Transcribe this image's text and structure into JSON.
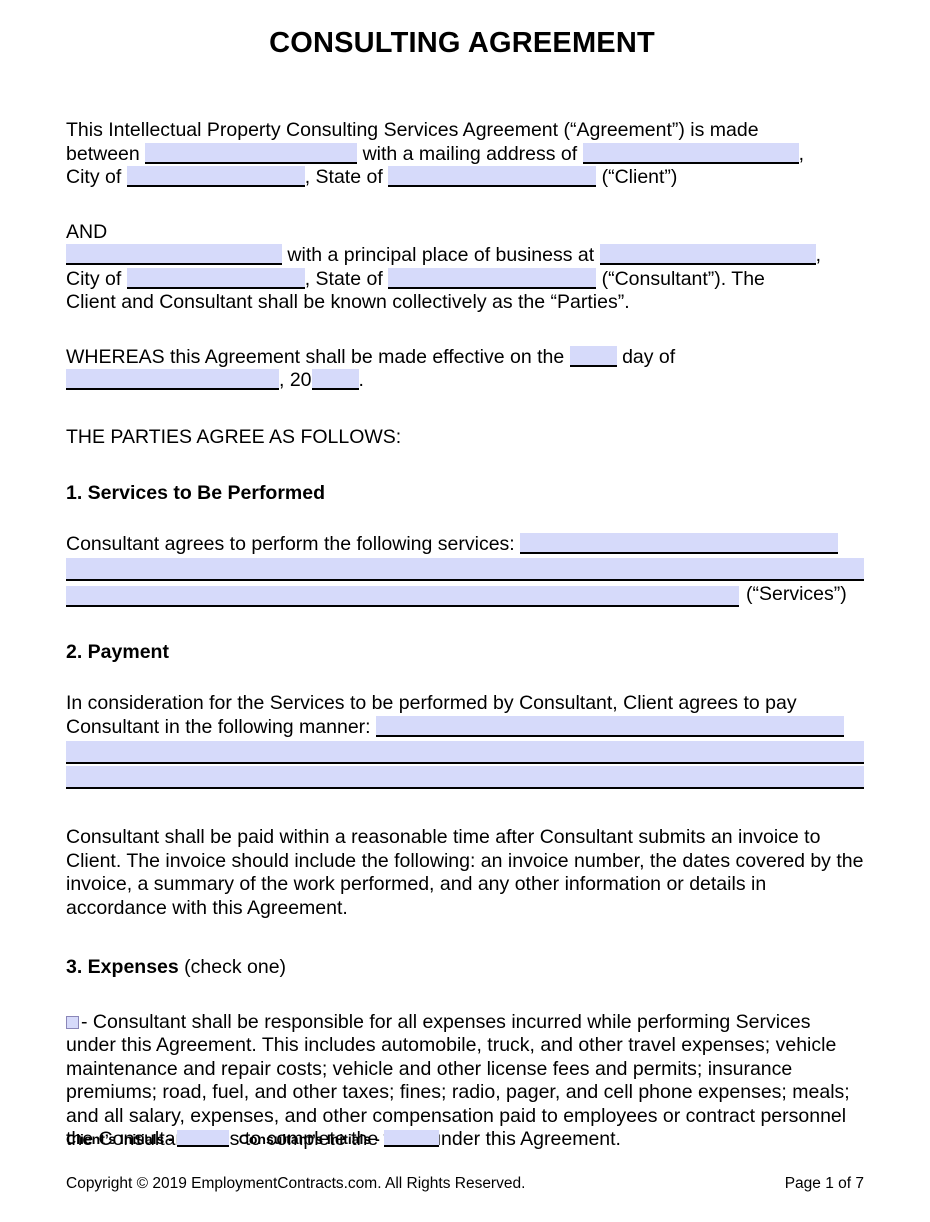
{
  "document": {
    "title": "CONSULTING AGREEMENT",
    "intro": {
      "line1_a": "This Intellectual Property Consulting Services Agreement (“Agreement”) is made",
      "line2_a": "between",
      "line2_b": "with a mailing address of",
      "line2_c": ",",
      "line3_a": "City of",
      "line3_b": ", State of",
      "line3_c": "(“Client”)"
    },
    "and_block": {
      "and_label": "AND",
      "line1_b": "with a principal place of business at",
      "line1_c": ",",
      "line2_a": "City of",
      "line2_b": ", State of",
      "line2_c": "(“Consultant”). The",
      "line3": "Client and Consultant shall be known collectively as the “Parties”."
    },
    "whereas": {
      "line1_a": "WHEREAS this Agreement shall be made effective on the",
      "line1_b": "day of",
      "line2_a": ", 20",
      "line2_b": "."
    },
    "parties_agree": "THE PARTIES AGREE AS FOLLOWS:",
    "section1": {
      "heading": "1. Services to Be Performed",
      "intro": "Consultant agrees to perform the following services:",
      "tail": "(“Services”)"
    },
    "section2": {
      "heading": "2. Payment",
      "intro_line1": "In consideration for the Services to be performed by Consultant, Client agrees to pay",
      "intro_line2": "Consultant in the following manner:",
      "invoice_paragraph": "Consultant shall be paid within a reasonable time after Consultant submits an invoice to Client. The invoice should include the following: an invoice number, the dates covered by the invoice, a summary of the work performed, and any other information or details in accordance with this Agreement."
    },
    "section3": {
      "heading_bold": "3. Expenses",
      "heading_normal": "(check one)",
      "option_a_dash": "-",
      "option_a_text": "Consultant shall be responsible for all expenses incurred while performing Services under this Agreement. This includes automobile, truck, and other travel expenses; vehicle maintenance and repair costs; vehicle and other license fees and permits; insurance premiums; road, fuel, and other taxes; fines; radio, pager, and cell phone expenses; meals; and all salary, expenses, and other compensation paid to employees or contract personnel the Consultant hires to complete the work under this Agreement."
    },
    "footer": {
      "client_initials_label": "Client’s Initials -",
      "consultant_initials_label": "Consultant’s Initials -",
      "copyright": "Copyright © 2019 EmploymentContracts.com. All Rights Reserved.",
      "page_number": "Page 1 of 7"
    },
    "colors": {
      "field_fill": "#d6dafa",
      "field_rule": "#000000",
      "checkbox_border": "#8a86b8",
      "text": "#000000",
      "page_background": "#ffffff"
    }
  }
}
